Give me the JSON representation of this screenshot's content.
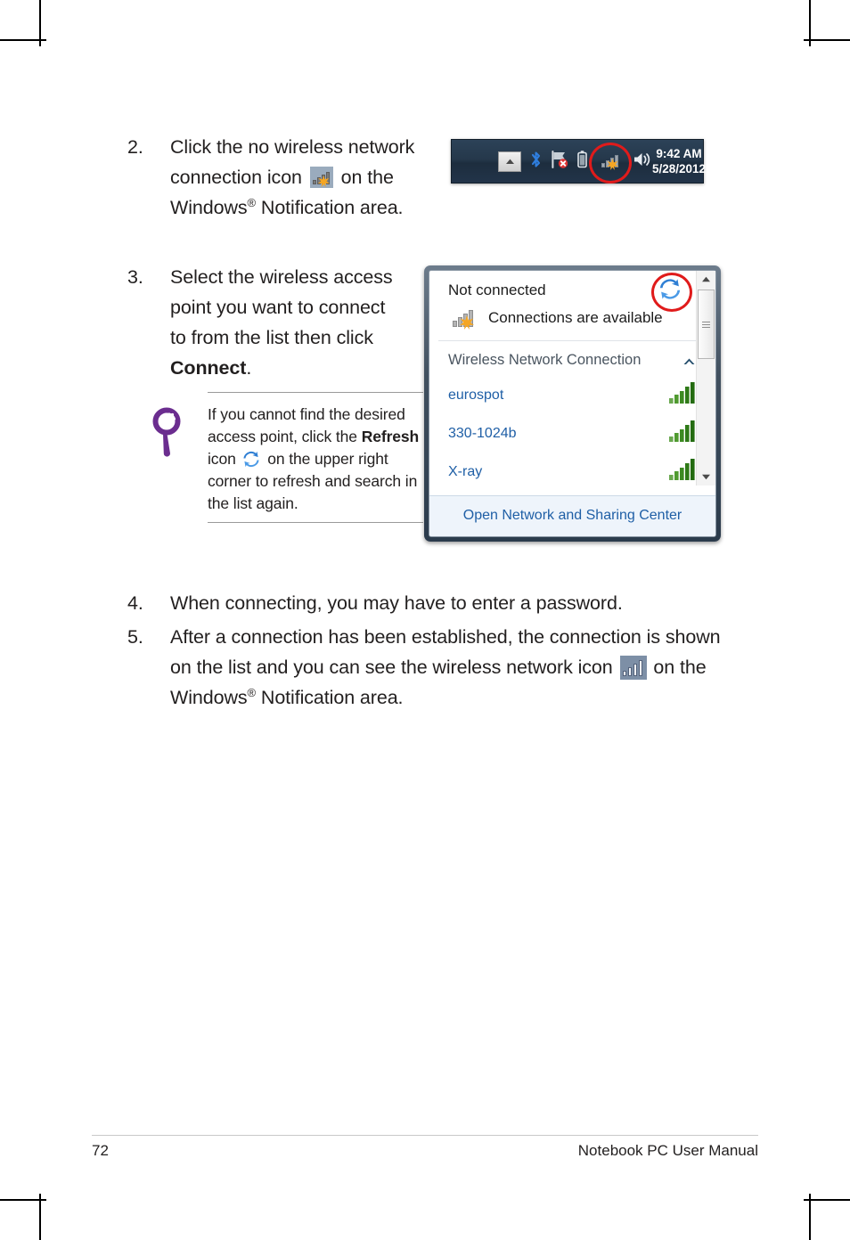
{
  "page": {
    "footer_page_number": "72",
    "footer_title": "Notebook PC User Manual"
  },
  "steps": [
    {
      "number": "2.",
      "text_before_icon": "Click the no wireless network connection icon",
      "icon": "no-wireless-connection-icon",
      "text_after_icon": "on the Windows",
      "registered": "®",
      "text_tail": " Notification area."
    },
    {
      "number": "3.",
      "text": "Select the wireless access point you want to connect to from the list then click ",
      "bold_word": "Connect",
      "text_tail": "."
    },
    {
      "number": "4.",
      "text": "When connecting, you may have to enter a password."
    },
    {
      "number": "5.",
      "text_before_icon": "After a connection has been established, the connection is shown on the list and you can see the wireless network icon",
      "icon": "wireless-network-icon",
      "text_after_icon": "on the Windows",
      "registered": "®",
      "text_tail": " Notification area."
    }
  ],
  "tip": {
    "icon": "magnifier-tip-icon",
    "icon_color": "#6B2D8F",
    "text_1": "If you cannot find the desired access point, click the ",
    "bold_word": "Refresh",
    "text_2": " icon ",
    "inline_icon": "refresh-icon",
    "text_3": " on the upper right corner to refresh and search in the list again."
  },
  "tray": {
    "icons": [
      "show-hidden-icons-chevron",
      "bluetooth-icon",
      "action-center-flag-icon",
      "battery-icon",
      "no-wireless-connection-icon",
      "volume-icon"
    ],
    "highlight_icon": "no-wireless-connection-icon",
    "highlight_color": "#E01B1B",
    "time": "9:42 AM",
    "date": "5/28/2012"
  },
  "flyout": {
    "status": "Not connected",
    "available_text": "Connections are available",
    "available_icon": "no-wireless-connection-icon",
    "refresh_icon": "refresh-icon",
    "refresh_highlight_color": "#E01B1B",
    "section_title": "Wireless Network Connection",
    "section_caret": "collapse-chevron-up-icon",
    "networks": [
      {
        "ssid": "eurospot",
        "signal_icon": "signal-bars-icon",
        "bars": 5
      },
      {
        "ssid": "330-1024b",
        "signal_icon": "signal-bars-icon",
        "bars": 5
      },
      {
        "ssid": "X-ray",
        "signal_icon": "signal-bars-icon",
        "bars": 5
      }
    ],
    "footer_link": "Open Network and Sharing Center",
    "scrollbar": {
      "up_arrow": "scroll-up-arrow-icon",
      "down_arrow": "scroll-down-arrow-icon",
      "thumb": "scrollbar-thumb"
    }
  }
}
